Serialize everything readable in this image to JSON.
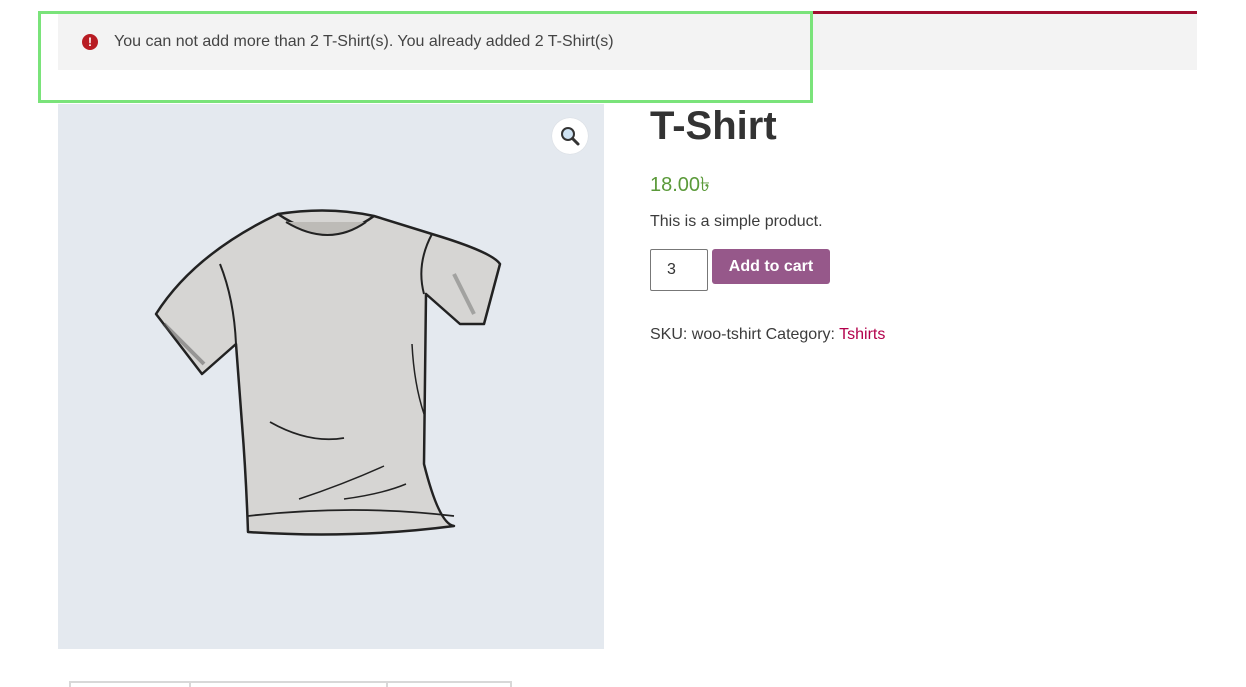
{
  "notice": {
    "icon": "exclamation-icon",
    "text": "You can not add more than 2 T-Shirt(s). You already added 2 T-Shirt(s)",
    "border_color": "#a00d2e"
  },
  "gallery": {
    "zoom_icon": "magnifier-icon",
    "zoom_glyph": "🔍",
    "image": "t-shirt-illustration"
  },
  "product": {
    "title": "T-Shirt",
    "price": "18.00৳",
    "description": "This is a simple product.",
    "quantity": "3",
    "add_to_cart_label": "Add to cart",
    "sku_label": "SKU:",
    "sku_value": "woo-tshirt",
    "category_label": "Category:",
    "category_value": "Tshirts"
  },
  "colors": {
    "price": "#5b9a3a",
    "button": "#96588a",
    "link": "#b3004b"
  }
}
